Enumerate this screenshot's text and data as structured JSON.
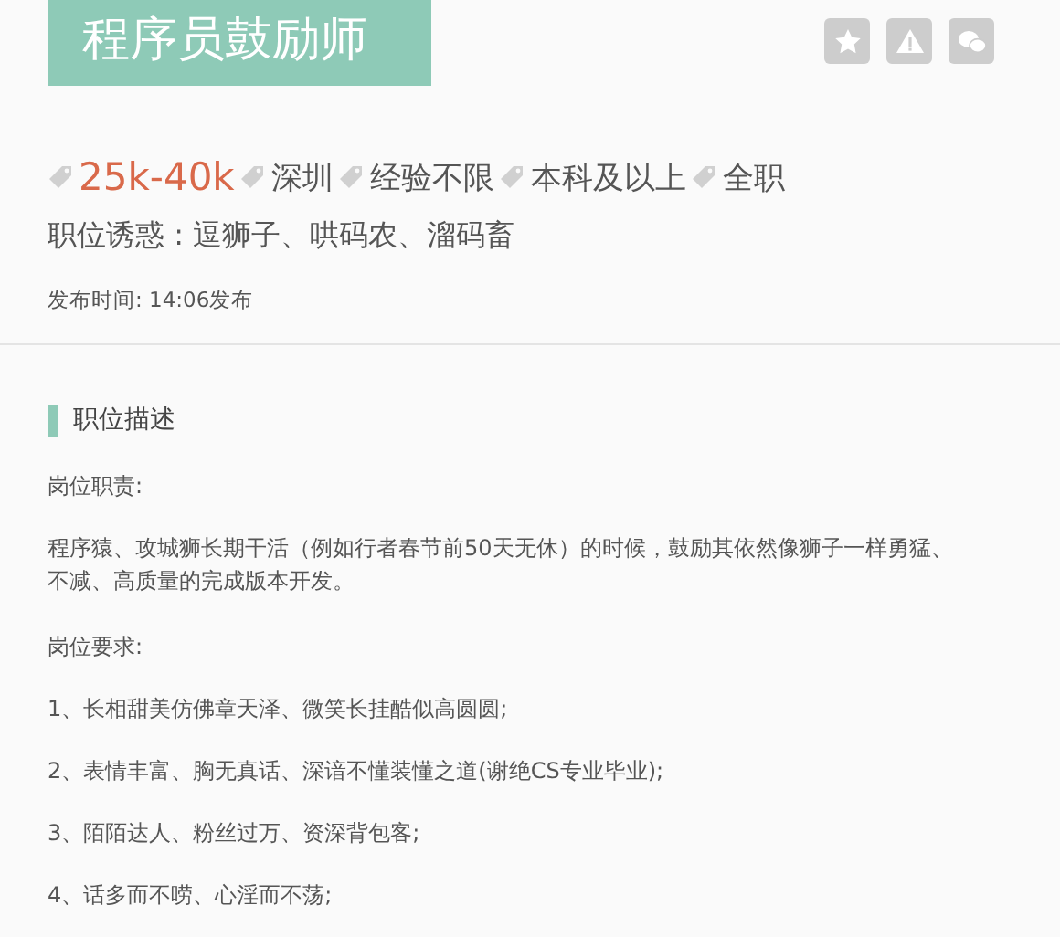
{
  "title": "程序员鼓励师",
  "actions": [
    {
      "kind": "star"
    },
    {
      "kind": "warning"
    },
    {
      "kind": "chat"
    }
  ],
  "tags": [
    {
      "label": "25k-40k",
      "kind": "salary"
    },
    {
      "label": "深圳",
      "kind": "plain"
    },
    {
      "label": "经验不限",
      "kind": "plain"
    },
    {
      "label": "本科及以上",
      "kind": "plain"
    },
    {
      "label": "全职",
      "kind": "plain"
    }
  ],
  "perks": "职位诱惑 : 逗狮子、哄码农、溜码畜",
  "published": "发布时间:  14:06发布",
  "section": {
    "heading": "职位描述",
    "blocks": [
      {
        "kind": "label",
        "lines": [
          "岗位职责:"
        ]
      },
      {
        "kind": "para",
        "lines": [
          "程序猿、攻城狮长期干活（例如行者春节前50天无休）的时候，鼓励其依然像狮子一样勇猛、",
          "不减、高质量的完成版本开发。"
        ]
      },
      {
        "kind": "label",
        "lines": [
          "岗位要求:"
        ]
      },
      {
        "kind": "para",
        "lines": [
          "1、长相甜美仿佛章天泽、微笑长挂酷似高圆圆;"
        ]
      },
      {
        "kind": "para",
        "lines": [
          "2、表情丰富、胸无真话、深谙不懂装懂之道(谢绝CS专业毕业);"
        ]
      },
      {
        "kind": "para",
        "lines": [
          "3、陌陌达人、粉丝过万、资深背包客;"
        ]
      },
      {
        "kind": "para",
        "lines": [
          "4、话多而不唠、心淫而不荡;"
        ]
      }
    ]
  }
}
